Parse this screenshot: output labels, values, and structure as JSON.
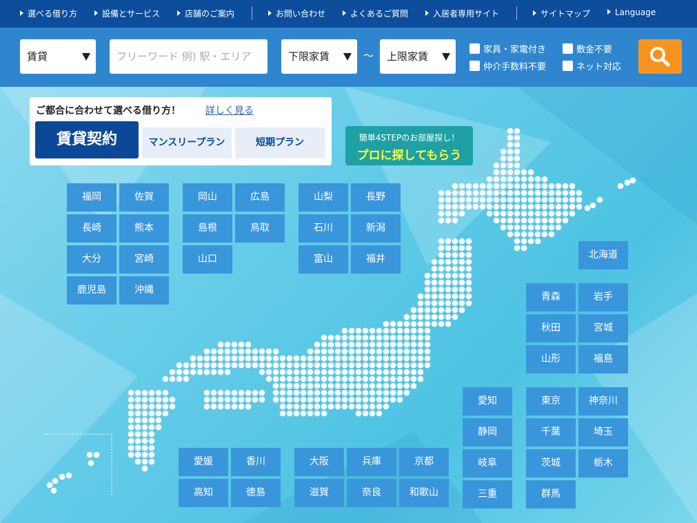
{
  "topnav": {
    "links": [
      "選べる借り方",
      "設備とサービス",
      "店舗のご案内",
      "お問い合わせ",
      "よくあるご質問",
      "入居者専用サイト",
      "サイトマップ",
      "Language"
    ]
  },
  "search": {
    "type_select": "賃貸",
    "freeword_placeholder": "フリーワード 例) 駅・エリア",
    "min_rent": "下限家賃",
    "tilde": "～",
    "max_rent": "上限家賃",
    "checkboxes": [
      "家具・家電付き",
      "敷金不要",
      "仲介手数料不要",
      "ネット対応"
    ],
    "accent_color": "#f7941d"
  },
  "plans": {
    "title": "ご都合に合わせて選べる借り方！",
    "more_link": "詳しく見る",
    "main": "賃貸契約",
    "monthly": "マンスリープラン",
    "short": "短期プラン"
  },
  "pro": {
    "line1": "簡単4STEPのお部屋探し！",
    "line2": "プロに探してもらう"
  },
  "prefectures": {
    "kyushu": [
      "福岡",
      "佐賀",
      "長崎",
      "熊本",
      "大分",
      "宮崎",
      "鹿児島",
      "沖縄"
    ],
    "chugoku": [
      "岡山",
      "広島",
      "島根",
      "鳥取",
      "山口"
    ],
    "chubu": [
      "山梨",
      "長野",
      "石川",
      "新潟",
      "富山",
      "福井"
    ],
    "hokkaido": [
      "北海道"
    ],
    "tohoku": [
      "青森",
      "岩手",
      "秋田",
      "宮城",
      "山形",
      "福島"
    ],
    "tokai": [
      "愛知",
      "静岡",
      "岐阜",
      "三重"
    ],
    "kanto": [
      "東京",
      "神奈川",
      "千葉",
      "埼玉",
      "茨城",
      "栃木",
      "群馬"
    ],
    "shikoku": [
      "愛媛",
      "香川",
      "高知",
      "徳島"
    ],
    "kinki": [
      "大阪",
      "兵庫",
      "京都",
      "滋賀",
      "奈良",
      "和歌山"
    ]
  }
}
